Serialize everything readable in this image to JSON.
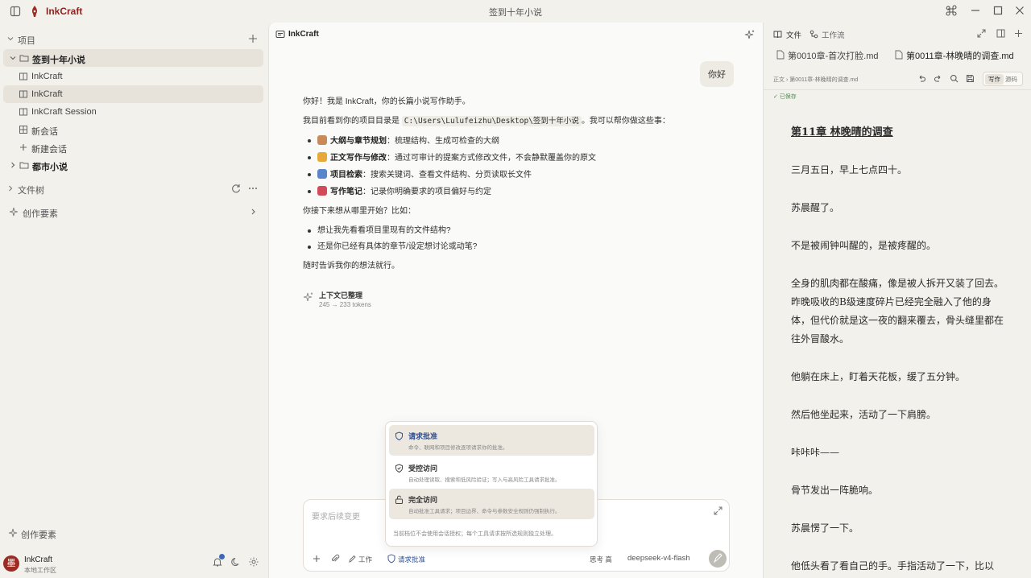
{
  "app": {
    "name": "InkCraft",
    "window_title": "签到十年小说"
  },
  "sidebar": {
    "projects_label": "项目",
    "projects": [
      {
        "name": "签到十年小说",
        "expanded": true,
        "children": [
          "InkCraft",
          "InkCraft",
          "InkCraft Session",
          "新会话"
        ],
        "new_session": "新建会话"
      },
      {
        "name": "都市小说",
        "expanded": false
      }
    ],
    "filetree_label": "文件树",
    "elements_label": "创作要素",
    "bottom_elements": "创作要素",
    "user": {
      "name": "InkCraft",
      "workspace": "本地工作区",
      "avatar": "墨"
    }
  },
  "chat": {
    "title": "InkCraft",
    "user_message": "你好",
    "reply": {
      "intro": "你好！我是 InkCraft，你的长篇小说写作助手。",
      "dir_prefix": "我目前看到你的项目目录是",
      "dir_path": "C:\\Users\\Lulufeizhu\\Desktop\\签到十年小说",
      "dir_suffix": "。我可以帮你做这些事：",
      "features": [
        {
          "title": "大纲与章节规划",
          "desc": "：梳理结构、生成可检查的大纲",
          "icon": "#c98a5a"
        },
        {
          "title": "正文写作与修改",
          "desc": "：通过可审计的提案方式修改文件，不会静默覆盖你的原文",
          "icon": "#e6a93a"
        },
        {
          "title": "项目检索",
          "desc": "：搜索关键词、查看文件结构、分页读取长文件",
          "icon": "#5a86c9"
        },
        {
          "title": "写作笔记",
          "desc": "：记录你明确要求的项目偏好与约定",
          "icon": "#d24b5a"
        }
      ],
      "question": "你接下来想从哪里开始？比如：",
      "suggestions": [
        "想让我先看看项目里现有的文件结构?",
        "还是你已经有具体的章节/设定想讨论或动笔?"
      ],
      "closing": "随时告诉我你的想法就行。"
    },
    "context": {
      "title": "上下文已整理",
      "tokens": "245 → 233 tokens"
    },
    "composer": {
      "placeholder": "要求后续变更",
      "mode": "工作",
      "approval": "请求批准",
      "thinking": "思考 高",
      "model": "deepseek-v4-flash"
    },
    "approval_menu": {
      "options": [
        {
          "title": "请求批准",
          "desc": "命令、联网和项目修改逐项请求你的批准。"
        },
        {
          "title": "受控访问",
          "desc": "自动处理读取、搜索和低风险验证；写入与高风险工具请求批准。"
        },
        {
          "title": "完全访问",
          "desc": "自动批准工具请求；项目边界、命令与参数安全规则仍强制执行。"
        }
      ],
      "note": "当前档位不会使用会话授权；每个工具请求按所选规则独立处理。"
    }
  },
  "right": {
    "tabs": [
      "文件",
      "工作流"
    ],
    "file_tabs": [
      "第0010章-首次打脸.md",
      "第0011章-林晚晴的调查.md"
    ],
    "breadcrumb": "正文 › 第0011章-林晚晴的调查.md",
    "mode_write": "写作",
    "mode_source": "源码",
    "saved": "已保存",
    "doc": {
      "heading": "第11章 林晚晴的调查",
      "paragraphs": [
        "三月五日，早上七点四十。",
        "苏晨醒了。",
        "不是被闹钟叫醒的，是被疼醒的。",
        "全身的肌肉都在酸痛，像是被人拆开又装了回去。昨晚吸收的B级速度碎片已经完全融入了他的身体，但代价就是这一夜的翻来覆去，骨头缝里都在往外冒酸水。",
        "他躺在床上，盯着天花板，缓了五分钟。",
        "然后他坐起来，活动了一下肩膀。",
        "咔咔咔——",
        "骨节发出一阵脆响。",
        "苏晨愣了一下。",
        "他低头看了看自己的手。手指活动了一下，比以"
      ]
    }
  }
}
